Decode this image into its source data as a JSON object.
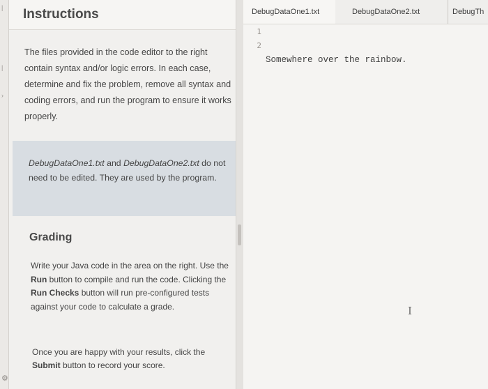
{
  "instructions": {
    "title": "Instructions",
    "intro": "The files provided in the code editor to the right contain syntax and/or logic errors. In each case, determine and fix the problem, remove all syntax and coding errors, and run the program to ensure it works properly.",
    "note": {
      "file1": "DebugDataOne1.txt",
      "and": " and ",
      "file2": "DebugDataOne2.txt",
      "rest": " do not need to be edited. They are used by the program."
    },
    "grading": {
      "title": "Grading",
      "p1_a": "Write your Java code in the area on the right. Use the ",
      "run": "Run",
      "p1_b": " button to compile and run the code. Clicking the ",
      "run_checks": "Run Checks",
      "p1_c": " button will run pre-configured tests against your code to calculate a grade.",
      "p2_a": "Once you are happy with your results, click the ",
      "submit": "Submit",
      "p2_b": " button to record your score."
    }
  },
  "editor": {
    "tabs": [
      {
        "label": "DebugDataOne1.txt",
        "active": true
      },
      {
        "label": "DebugDataOne2.txt",
        "active": false
      },
      {
        "label": "DebugTh",
        "active": false
      }
    ],
    "line_numbers": [
      "1",
      "2"
    ],
    "lines": [
      "Somewhere over the rainbow.",
      ""
    ]
  },
  "icons": {
    "settings": "gear-icon",
    "text_cursor": "i-beam-cursor-icon"
  }
}
